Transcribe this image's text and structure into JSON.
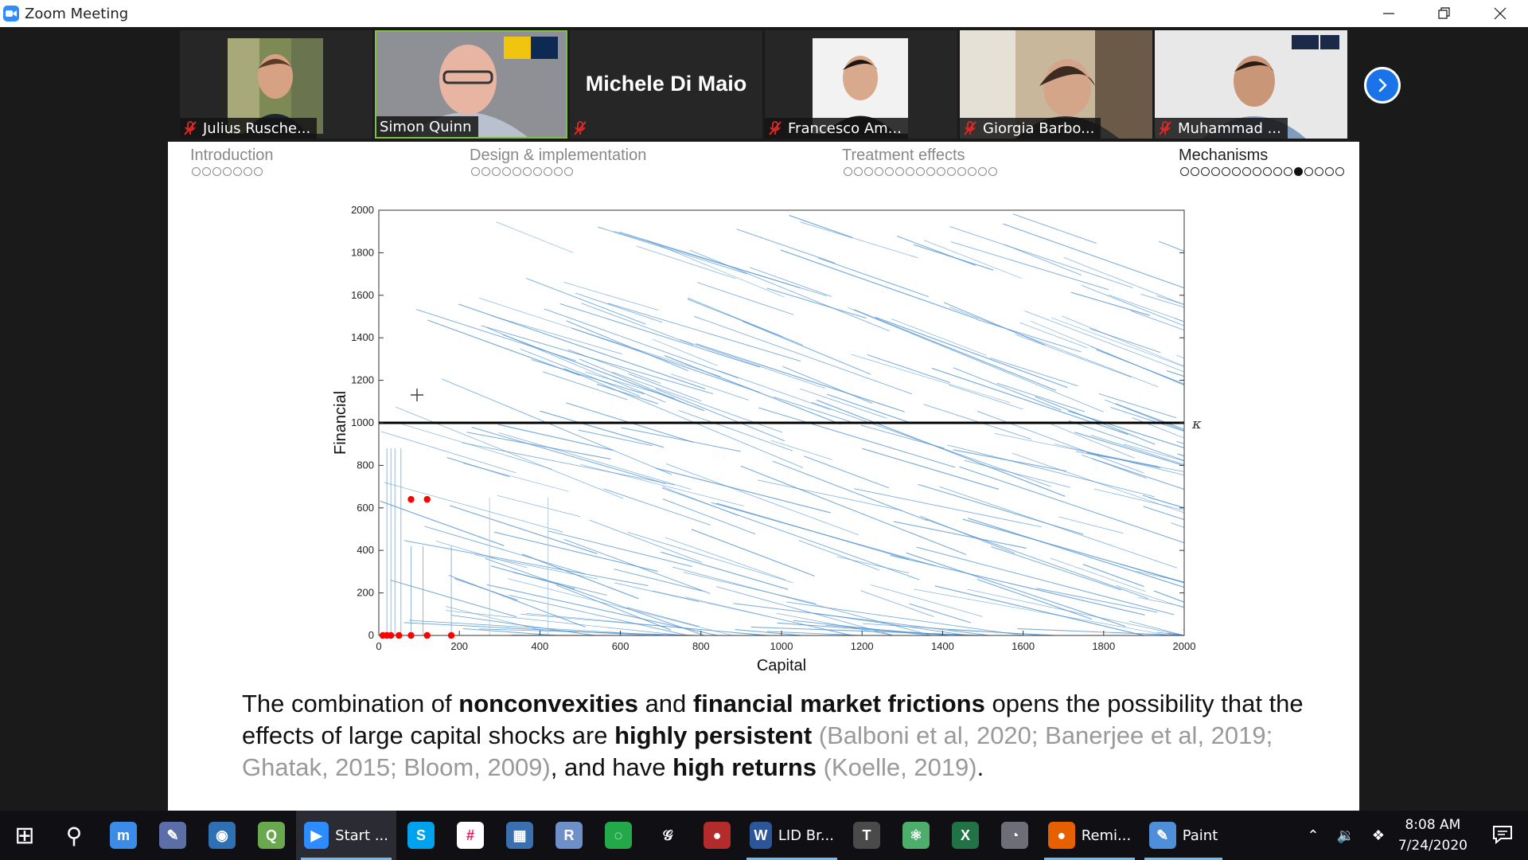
{
  "window": {
    "title": "Zoom Meeting",
    "controls": [
      "minimize",
      "restore",
      "close"
    ]
  },
  "participants": [
    {
      "name": "Julius Rusche...",
      "muted": true,
      "active": false
    },
    {
      "name": "Simon Quinn",
      "muted": false,
      "active": true
    },
    {
      "name": "Michele Di Maio",
      "muted": true,
      "active": false,
      "video": false
    },
    {
      "name": "Francesco Am...",
      "muted": true,
      "active": false
    },
    {
      "name": "Giorgia Barbo...",
      "muted": true,
      "active": false
    },
    {
      "name": "Muhammad ...",
      "muted": true,
      "active": false
    }
  ],
  "slide": {
    "sections": [
      {
        "label": "Introduction",
        "dots": 7,
        "current": -1
      },
      {
        "label": "Design & implementation",
        "dots": 10,
        "current": -1
      },
      {
        "label": "Treatment effects",
        "dots": 15,
        "current": -1
      },
      {
        "label": "Mechanisms",
        "dots": 16,
        "current": 11
      }
    ],
    "body": {
      "p1": "The combination of ",
      "b1": "nonconvexities",
      "p2": " and ",
      "b2": "financial market frictions",
      "p3": " opens the possibility that the effects of large capital shocks are ",
      "b3": "highly persistent",
      "c1": " (Balboni et al, 2020; Banerjee et al, 2019; Ghatak, 2015; Bloom, 2009)",
      "p4": ", and have ",
      "b4": "high returns",
      "c2": " (Koelle, 2019)",
      "p5": "."
    }
  },
  "chart_data": {
    "type": "scatter",
    "title": "",
    "xlabel": "Capital",
    "ylabel": "Financial",
    "xlim": [
      0,
      2000
    ],
    "ylim": [
      0,
      2000
    ],
    "xticks": [
      0,
      200,
      400,
      600,
      800,
      1000,
      1200,
      1400,
      1600,
      1800,
      2000
    ],
    "yticks": [
      0,
      200,
      400,
      600,
      800,
      1000,
      1200,
      1400,
      1600,
      1800,
      2000
    ],
    "threshold": {
      "label": "κ",
      "y": 1000
    },
    "series": [
      {
        "values": [
          [
            10,
            0
          ],
          [
            20,
            0
          ],
          [
            30,
            0
          ],
          [
            50,
            0
          ],
          [
            80,
            0
          ],
          [
            120,
            0
          ],
          [
            180,
            0
          ],
          [
            80,
            640
          ],
          [
            120,
            640
          ]
        ],
        "color": "#ff0000"
      }
    ],
    "quiver_color": "#4a90d0",
    "grid": false
  },
  "taskbar": {
    "items": [
      {
        "icon": "windows-start-icon",
        "label": ""
      },
      {
        "icon": "search-icon",
        "label": ""
      },
      {
        "icon": "app-icon",
        "label": ""
      },
      {
        "icon": "texstudio-icon",
        "label": ""
      },
      {
        "icon": "globe-icon",
        "label": ""
      },
      {
        "icon": "qgis-icon",
        "label": ""
      },
      {
        "icon": "zoom-icon",
        "label": "Start ..."
      },
      {
        "icon": "skype-icon",
        "label": ""
      },
      {
        "icon": "slack-icon",
        "label": ""
      },
      {
        "icon": "calculator-icon",
        "label": ""
      },
      {
        "icon": "r-icon",
        "label": ""
      },
      {
        "icon": "spinner-icon",
        "label": ""
      },
      {
        "icon": "script-icon",
        "label": ""
      },
      {
        "icon": "mendeley-icon",
        "label": ""
      },
      {
        "icon": "word-icon",
        "label": "LID Br..."
      },
      {
        "icon": "tex-icon",
        "label": ""
      },
      {
        "icon": "atom-icon",
        "label": ""
      },
      {
        "icon": "excel-icon",
        "label": ""
      },
      {
        "icon": "github-icon",
        "label": ""
      },
      {
        "icon": "firefox-icon",
        "label": "Remi..."
      },
      {
        "icon": "paint-icon",
        "label": "Paint"
      }
    ],
    "time": "8:08 AM",
    "date": "7/24/2020"
  }
}
